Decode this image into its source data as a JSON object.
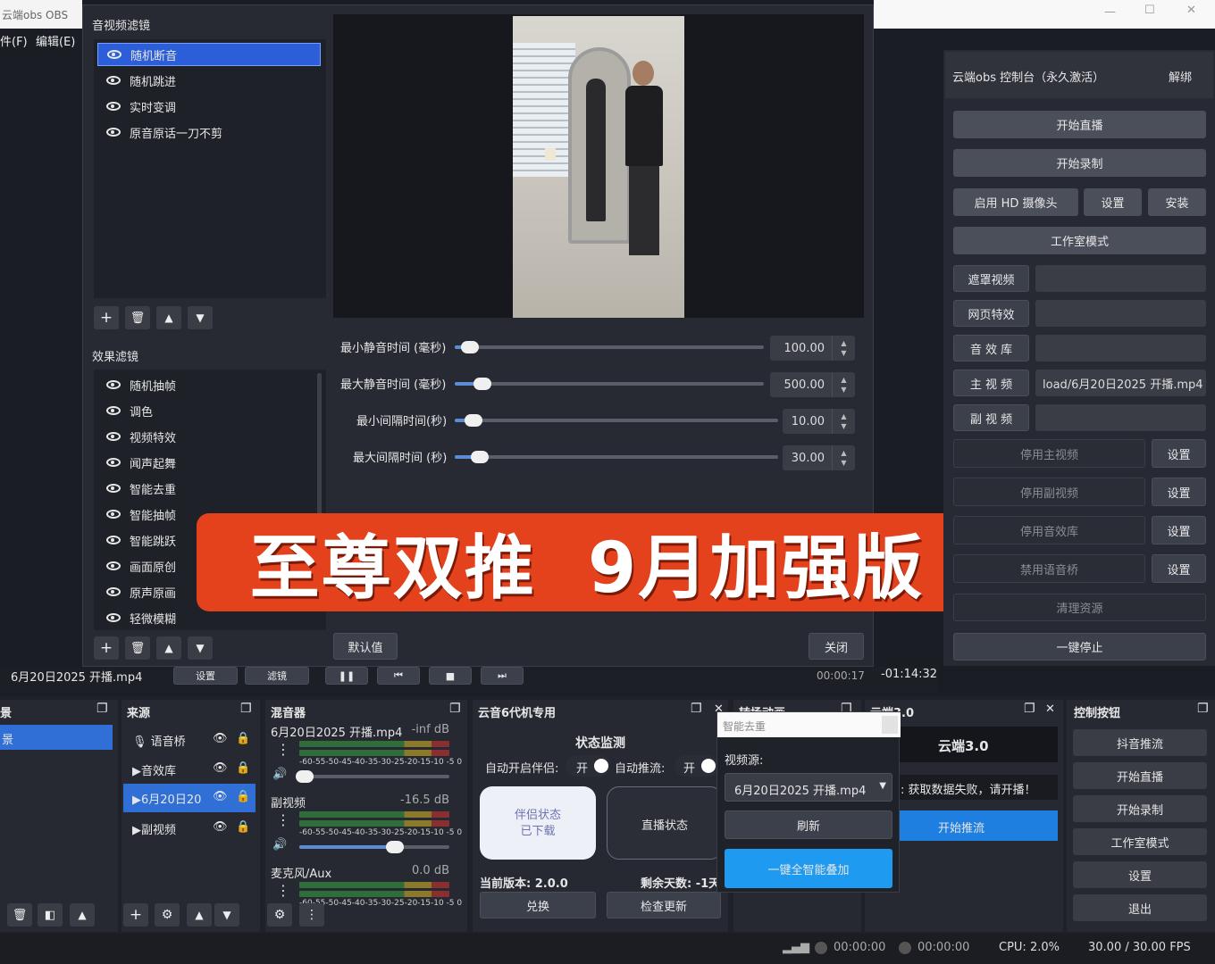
{
  "window": {
    "title": "云端obs OBS"
  },
  "menu": [
    "件(F)",
    "编辑(E)"
  ],
  "filters_dialog": {
    "audio_section_title": "音视频滤镜",
    "audio_filters": [
      "随机断音",
      "随机跳进",
      "实时变调",
      "原音原话一刀不剪"
    ],
    "effect_section_title": "效果滤镜",
    "effect_filters": [
      "随机抽帧",
      "调色",
      "视频特效",
      "闻声起舞",
      "智能去重",
      "智能抽帧",
      "智能跳跃",
      "画面原创",
      "原声原画",
      "轻微模糊"
    ],
    "params": [
      {
        "label": "最小静音时间 (毫秒)",
        "value": "100.00",
        "fill": 0.02
      },
      {
        "label": "最大静音时间 (毫秒)",
        "value": "500.00",
        "fill": 0.06
      },
      {
        "label": "最小间隔时间(秒)",
        "value": "10.00",
        "fill": 0.03
      },
      {
        "label": "最大间隔时间 (秒)",
        "value": "30.00",
        "fill": 0.05
      }
    ],
    "defaults_button": "默认值",
    "close_button": "关闭"
  },
  "banner": {
    "text": "至尊双推  9月加强版"
  },
  "control_panel": {
    "title": "云端obs 控制台（永久激活）",
    "unbind": "解绑",
    "start_stream": "开始直播",
    "start_record": "开始录制",
    "hd_camera": "启用 HD 摄像头",
    "settings": "设置",
    "install": "安装",
    "studio_mode": "工作室模式",
    "rows": [
      {
        "label": "遮罩视频",
        "value": ""
      },
      {
        "label": "网页特效",
        "value": ""
      },
      {
        "label": "音 效 库",
        "value": ""
      },
      {
        "label": "主 视 频",
        "value": "load/6月20日2025 开播.mp4"
      },
      {
        "label": "副 视 频",
        "value": ""
      }
    ],
    "toggles": [
      {
        "label": "停用主视频",
        "btn": "设置"
      },
      {
        "label": "停用副视频",
        "btn": "设置"
      },
      {
        "label": "停用音效库",
        "btn": "设置"
      },
      {
        "label": "禁用语音桥",
        "btn": "设置"
      }
    ],
    "clean": "清理资源",
    "stop_all": "一键停止"
  },
  "playback": {
    "file": "6月20日2025 开播.mp4",
    "settings": "设置",
    "filters": "滤镜",
    "time": "00:00:17",
    "remaining": "-01:14:32"
  },
  "docks": {
    "scene_title": "景",
    "scene_item": "景",
    "sources_title": "来源",
    "sources": [
      "语音桥",
      "音效库",
      "6月20日20",
      "副视频"
    ],
    "mixer_title": "混音器",
    "mixer": [
      {
        "name": "6月20日2025 开播.mp4",
        "db": "-inf dB",
        "level": 0.0
      },
      {
        "name": "副视频",
        "db": "-16.5 dB",
        "level": 0.6
      },
      {
        "name": "麦克风/Aux",
        "db": "0.0 dB",
        "level": 0.0
      }
    ],
    "scale": "-60-55-50-45-40-35-30-25-20-15-10 -5  0",
    "agent_title": "云音6代机专用",
    "status_title": "状态监测",
    "auto_partner": "自动开启伴侣:",
    "auto_push": "自动推流:",
    "on": "开",
    "partner_btn_1": "伴侣状态",
    "partner_btn_2": "已下载",
    "live_status": "直播状态",
    "version": "当前版本: 2.0.0",
    "days": "剩余天数: -1天",
    "exchange": "兑换",
    "check_update": "检查更新",
    "transition_title": "转场动画",
    "cloud_title": "云端3.0",
    "cloud_heading": "云端3.0",
    "cloud_error": ": 获取数据失败，请开播！",
    "start_push": "开始推流",
    "controls_title": "控制按钮",
    "controls": [
      "抖音推流",
      "开始直播",
      "开始录制",
      "工作室模式",
      "设置",
      "退出"
    ]
  },
  "popup": {
    "search_placeholder": "智能去重",
    "source_label": "视频源:",
    "source_value": "6月20日2025 开播.mp4",
    "refresh": "刷新",
    "overlay": "一键全智能叠加"
  },
  "status_bar": {
    "rec_time": "00:00:00",
    "stream_time": "00:00:00",
    "cpu": "CPU: 2.0%",
    "fps": "30.00 / 30.00 FPS"
  }
}
